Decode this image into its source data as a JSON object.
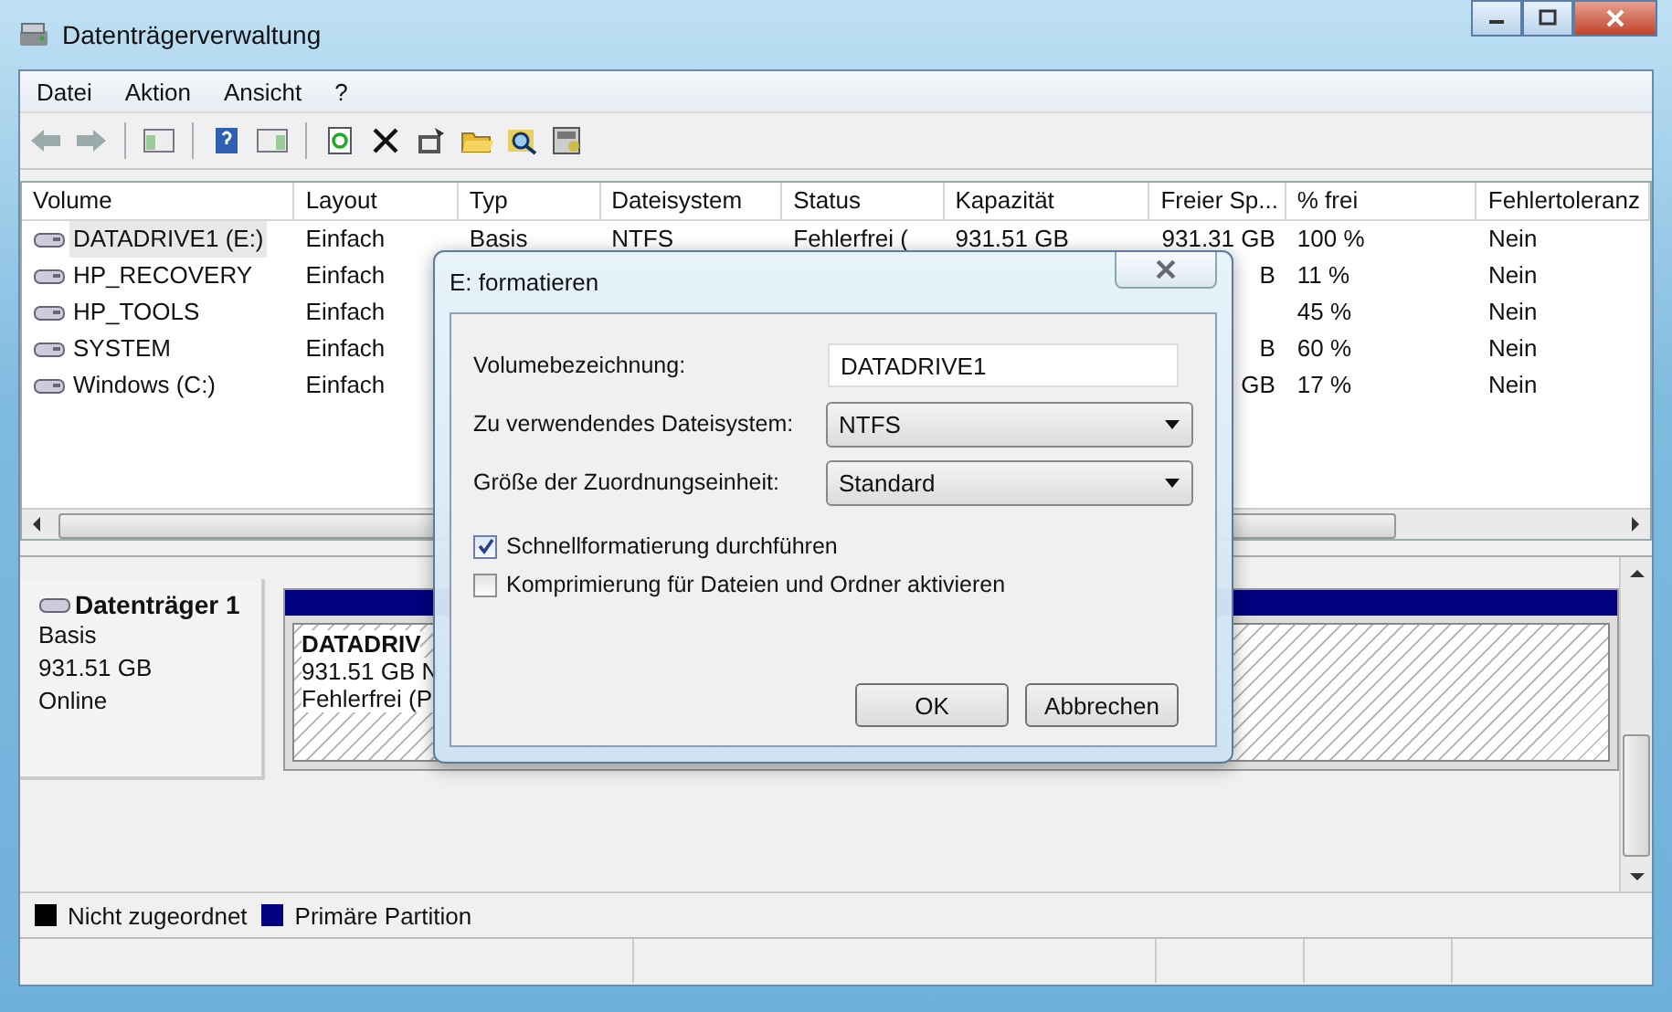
{
  "window": {
    "title": "Datenträgerverwaltung"
  },
  "menu": [
    "Datei",
    "Aktion",
    "Ansicht",
    "?"
  ],
  "table": {
    "columns": [
      "Volume",
      "Layout",
      "Typ",
      "Dateisystem",
      "Status",
      "Kapazität",
      "Freier Sp...",
      "% frei",
      "Fehlertoleranz"
    ],
    "rows": [
      {
        "selected": true,
        "volume": "DATADRIVE1 (E:)",
        "layout": "Einfach",
        "typ": "Basis",
        "dateisystem": "NTFS",
        "status": "Fehlerfrei (",
        "kapazitaet": "931.51 GB",
        "freier_speicher": "931.31 GB",
        "prozent_frei": "100 %",
        "fehlertoleranz": "Nein"
      },
      {
        "selected": false,
        "volume": "HP_RECOVERY",
        "layout": "Einfach",
        "freier_speicher": "B",
        "prozent_frei": "11 %",
        "fehlertoleranz": "Nein"
      },
      {
        "selected": false,
        "volume": "HP_TOOLS",
        "layout": "Einfach",
        "prozent_frei": "45 %",
        "fehlertoleranz": "Nein"
      },
      {
        "selected": false,
        "volume": "SYSTEM",
        "layout": "Einfach",
        "freier_speicher": "B",
        "prozent_frei": "60 %",
        "fehlertoleranz": "Nein"
      },
      {
        "selected": false,
        "volume": "Windows  (C:)",
        "layout": "Einfach",
        "freier_speicher": "GB",
        "prozent_frei": "17 %",
        "fehlertoleranz": "Nein"
      }
    ]
  },
  "disk": {
    "name": "Datenträger 1",
    "type": "Basis",
    "size": "931.51 GB",
    "state": "Online",
    "partition": {
      "name": "DATADRIV",
      "size": "931.51 GB N",
      "status": "Fehlerfrei (P"
    }
  },
  "legend": [
    {
      "label": "Nicht zugeordnet",
      "color": "#000000"
    },
    {
      "label": "Primäre Partition",
      "color": "#000080"
    }
  ],
  "dialog": {
    "title": "E: formatieren",
    "fields": [
      {
        "kind": "text",
        "label": "Volumebezeichnung:",
        "value": "DATADRIVE1"
      },
      {
        "kind": "select",
        "label": "Zu verwendendes Dateisystem:",
        "value": "NTFS"
      },
      {
        "kind": "select",
        "label": "Größe der Zuordnungseinheit:",
        "value": "Standard"
      }
    ],
    "checkboxes": [
      {
        "label": "Schnellformatierung durchführen",
        "checked": true
      },
      {
        "label": "Komprimierung für Dateien und Ordner aktivieren",
        "checked": false
      }
    ],
    "buttons": [
      "OK",
      "Abbrechen"
    ]
  }
}
